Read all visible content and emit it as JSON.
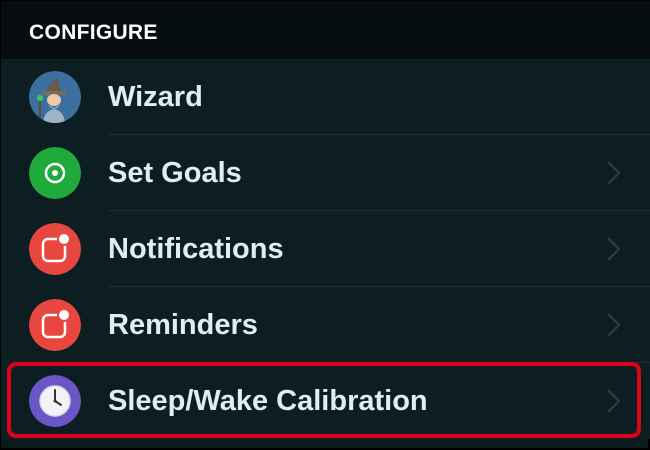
{
  "section": {
    "title": "CONFIGURE"
  },
  "items": [
    {
      "label": "Wizard",
      "icon": "wizard-avatar-icon",
      "color": "#3b6f9e",
      "chevron": false
    },
    {
      "label": "Set Goals",
      "icon": "target-icon",
      "color": "#1faa3b",
      "chevron": true
    },
    {
      "label": "Notifications",
      "icon": "notification-badge-icon",
      "color": "#e8473f",
      "chevron": true
    },
    {
      "label": "Reminders",
      "icon": "reminder-badge-icon",
      "color": "#e8473f",
      "chevron": true
    },
    {
      "label": "Sleep/Wake Calibration",
      "icon": "clock-icon",
      "color": "#6a56c6",
      "chevron": true
    }
  ],
  "colors": {
    "background": "#0d1e23",
    "header_background": "#050d10",
    "text": "#e3ecef",
    "highlight": "#e0001b"
  }
}
